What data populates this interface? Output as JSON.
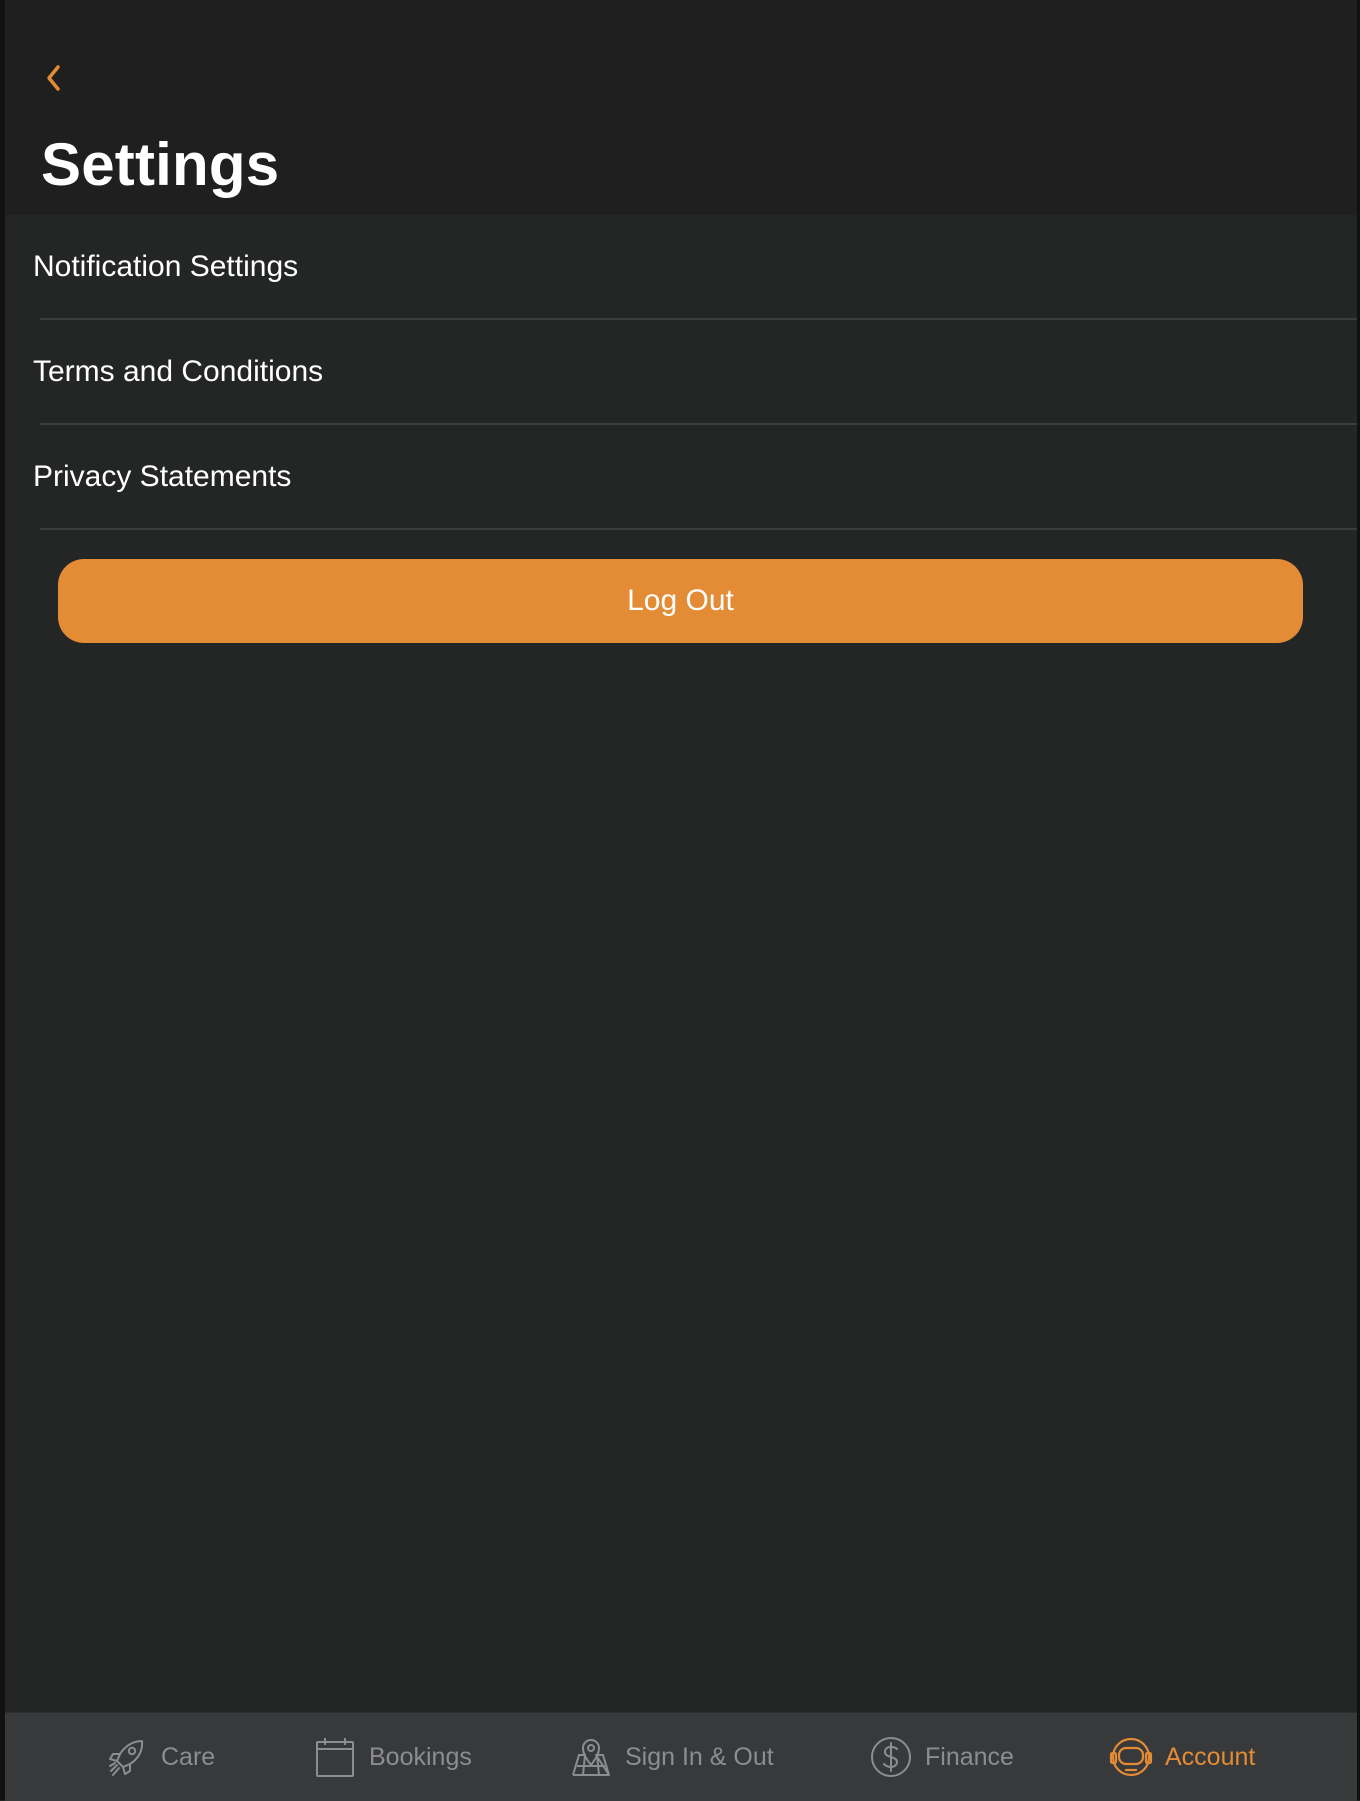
{
  "header": {
    "title": "Settings",
    "back_icon": "chevron-left-icon"
  },
  "settings_list": {
    "items": [
      {
        "label": "Notification Settings"
      },
      {
        "label": "Terms and Conditions"
      },
      {
        "label": "Privacy Statements"
      }
    ]
  },
  "logout": {
    "label": "Log Out"
  },
  "tab_bar": {
    "tabs": [
      {
        "label": "Care",
        "icon": "rocket-icon",
        "active": false
      },
      {
        "label": "Bookings",
        "icon": "calendar-icon",
        "active": false
      },
      {
        "label": "Sign In & Out",
        "icon": "map-pin-icon",
        "active": false
      },
      {
        "label": "Finance",
        "icon": "dollar-circle-icon",
        "active": false
      },
      {
        "label": "Account",
        "icon": "astronaut-helmet-icon",
        "active": true
      }
    ]
  },
  "colors": {
    "accent": "#e38b35",
    "background": "#242525",
    "header_background": "#1f1f1f",
    "tab_bar_background": "#38393b",
    "inactive_tab": "#8c8d90",
    "text": "#ffffff"
  }
}
